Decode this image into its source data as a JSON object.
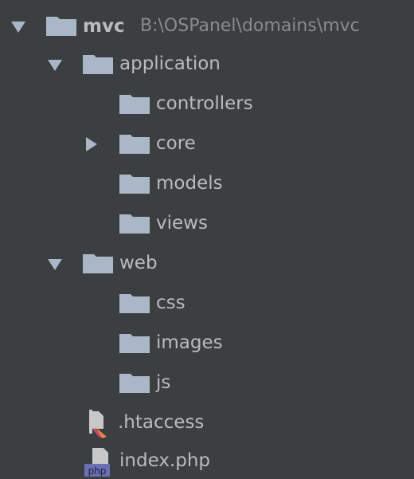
{
  "root": {
    "name": "mvc",
    "path": "B:\\OSPanel\\domains\\mvc"
  },
  "items": [
    {
      "label": "application"
    },
    {
      "label": "controllers"
    },
    {
      "label": "core"
    },
    {
      "label": "models"
    },
    {
      "label": "views"
    },
    {
      "label": "web"
    },
    {
      "label": "css"
    },
    {
      "label": "images"
    },
    {
      "label": "js"
    },
    {
      "label": ".htaccess"
    },
    {
      "label": "index.php"
    }
  ],
  "icons": {
    "folder": "folder-icon",
    "htaccess": "htaccess-file-icon",
    "php": "php-file-icon",
    "expanded": "chevron-down-icon",
    "collapsed": "chevron-right-icon"
  },
  "colors": {
    "background": "#3c3f41",
    "text": "#bbbbbb",
    "path_text": "#8a8a8a",
    "folder": "#a9b7c6",
    "php_badge": "#6b6fb3"
  }
}
